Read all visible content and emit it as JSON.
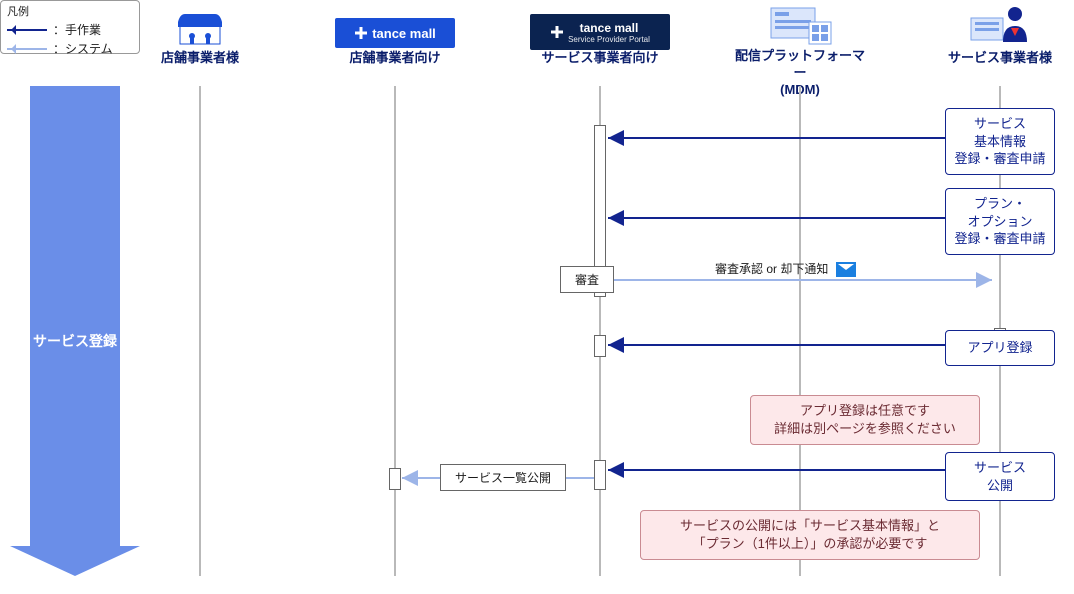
{
  "legend": {
    "title": "凡例",
    "manual": "：手作業",
    "system": "：システム"
  },
  "phase": {
    "label": "サービス登録"
  },
  "lanes": {
    "shop": {
      "label": "店舗事業者様"
    },
    "shop_mall": {
      "label": "店舗事業者向け",
      "badge": "tance mall"
    },
    "sp_mall": {
      "label": "サービス事業者向け",
      "badge": "tance mall",
      "sub": "Service Provider Portal"
    },
    "mdm": {
      "label_l1": "配信プラットフォーマー",
      "label_l2": "(MDM)"
    },
    "sp": {
      "label": "サービス事業者様"
    }
  },
  "actions": {
    "svc_basic": {
      "l1": "サービス",
      "l2": "基本情報",
      "l3": "登録・審査申請"
    },
    "plan": {
      "l1": "プラン・",
      "l2": "オプション",
      "l3": "登録・審査申請"
    },
    "review": "審査",
    "review_msg": "審査承認 or 却下通知",
    "app_reg": "アプリ登録",
    "app_note": {
      "l1": "アプリ登録は任意です",
      "l2": "詳細は別ページを参照ください"
    },
    "publish": {
      "l1": "サービス",
      "l2": "公開"
    },
    "pub_list": "サービス一覧公開",
    "pub_note": {
      "l1": "サービスの公開には「サービス基本情報」と",
      "l2": "「プラン（1件以上）」の承認が必要です"
    }
  },
  "chart_data": {
    "type": "sequence",
    "participants": [
      {
        "id": "shop",
        "name": "店舗事業者様"
      },
      {
        "id": "shop_mall",
        "name": "tance mall 店舗事業者向け"
      },
      {
        "id": "sp_mall",
        "name": "tance mall サービス事業者向け (Service Provider Portal)"
      },
      {
        "id": "mdm",
        "name": "配信プラットフォーマー (MDM)"
      },
      {
        "id": "sp",
        "name": "サービス事業者様"
      }
    ],
    "arrow_types": {
      "manual": "手作業",
      "system": "システム"
    },
    "messages": [
      {
        "from": "sp",
        "to": "sp_mall",
        "type": "manual",
        "label": "サービス基本情報 登録・審査申請"
      },
      {
        "from": "sp",
        "to": "sp_mall",
        "type": "manual",
        "label": "プラン・オプション 登録・審査申請"
      },
      {
        "at": "sp_mall",
        "type": "self",
        "label": "審査"
      },
      {
        "from": "sp_mall",
        "to": "sp",
        "type": "system",
        "label": "審査承認 or 却下通知",
        "icon": "mail"
      },
      {
        "from": "sp",
        "to": "sp_mall",
        "type": "manual",
        "label": "アプリ登録"
      },
      {
        "note_over": [
          "mdm",
          "sp"
        ],
        "text": "アプリ登録は任意です 詳細は別ページを参照ください"
      },
      {
        "from": "sp",
        "to": "sp_mall",
        "type": "manual",
        "label": "サービス公開"
      },
      {
        "from": "sp_mall",
        "to": "shop_mall",
        "type": "system",
        "label": "サービス一覧公開"
      },
      {
        "note_over": [
          "sp_mall",
          "sp"
        ],
        "text": "サービスの公開には「サービス基本情報」と「プラン（1件以上）」の承認が必要です"
      }
    ],
    "phase": "サービス登録"
  }
}
